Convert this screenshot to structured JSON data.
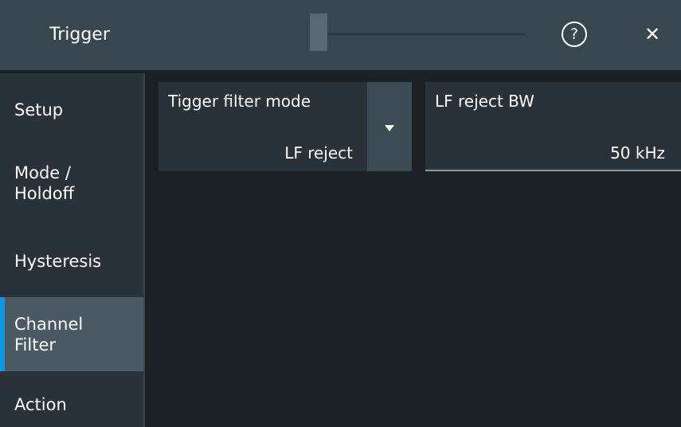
{
  "window": {
    "title": "Trigger",
    "help_symbol": "?",
    "close_symbol": "✕",
    "slider_position": 0.0
  },
  "sidebar": {
    "items": [
      {
        "label": "Setup",
        "active": false
      },
      {
        "label": "Mode /\nHoldoff",
        "active": false
      },
      {
        "label": "Hysteresis",
        "active": false
      },
      {
        "label": "Channel\nFilter",
        "active": true
      },
      {
        "label": "Action",
        "active": false
      }
    ],
    "accent_color": "#1496e6"
  },
  "fields": {
    "filter_mode": {
      "label": "Tigger filter mode",
      "value": "LF reject"
    },
    "lf_reject_bw": {
      "label": "LF reject BW",
      "value": "50 kHz"
    }
  },
  "icons": {
    "help": "help-circle-icon",
    "close": "close-icon",
    "dropdown": "chevron-down-icon"
  }
}
